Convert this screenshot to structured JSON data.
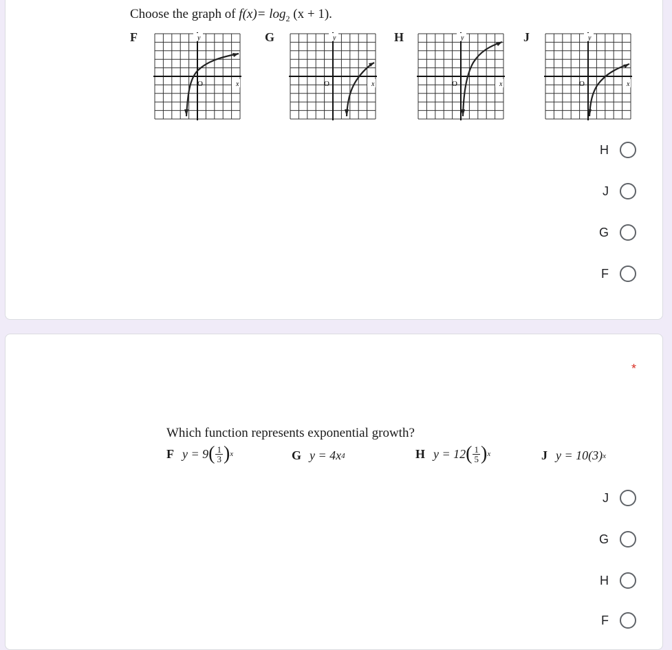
{
  "q1": {
    "title_prefix": "Choose the graph of ",
    "title_func": "f(x)= log",
    "title_sub": "2",
    "title_suffix": " (x + 1).",
    "graphs": [
      {
        "letter": "F",
        "ylabel": "y",
        "xlabel": "x",
        "origin": "O"
      },
      {
        "letter": "G",
        "ylabel": "y",
        "xlabel": "x",
        "origin": "O"
      },
      {
        "letter": "H",
        "ylabel": "y",
        "xlabel": "x",
        "origin": "O"
      },
      {
        "letter": "J",
        "ylabel": "y",
        "xlabel": "x",
        "origin": "O"
      }
    ],
    "choices": [
      "H",
      "J",
      "G",
      "F"
    ]
  },
  "q2": {
    "required_mark": "*",
    "title": "Which function represents exponential growth?",
    "options": {
      "F": {
        "key": "F",
        "prefix": "y = 9",
        "frac_num": "1",
        "frac_den": "3",
        "exp": "x"
      },
      "G": {
        "key": "G",
        "text": "y = 4x",
        "exp": "4"
      },
      "H": {
        "key": "H",
        "prefix": "y = 12",
        "frac_num": "1",
        "frac_den": "5",
        "exp": "x"
      },
      "J": {
        "key": "J",
        "text": "y = 10(3)",
        "exp": "x"
      }
    },
    "choices": [
      "J",
      "G",
      "H",
      "F"
    ]
  },
  "colors": {
    "page_bg": "#f0ebf8",
    "card_bg": "#ffffff",
    "radio_border": "#5f6368",
    "required": "#d93025"
  }
}
